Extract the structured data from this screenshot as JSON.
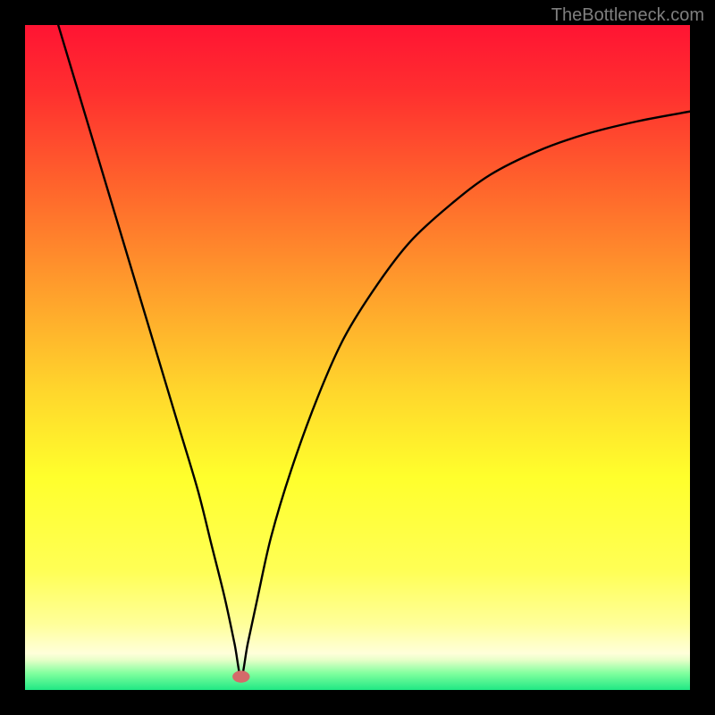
{
  "watermark": "TheBottleneck.com",
  "chart_data": {
    "type": "line",
    "title": "",
    "xlabel": "",
    "ylabel": "",
    "xlim": [
      0,
      100
    ],
    "ylim": [
      0,
      100
    ],
    "min_point_x": 32.5,
    "gradient_stops": [
      {
        "offset": 0.0,
        "color": "#ff1433"
      },
      {
        "offset": 0.1,
        "color": "#ff2f2f"
      },
      {
        "offset": 0.25,
        "color": "#ff672c"
      },
      {
        "offset": 0.4,
        "color": "#ff9f2c"
      },
      {
        "offset": 0.55,
        "color": "#ffd62c"
      },
      {
        "offset": 0.68,
        "color": "#ffff2c"
      },
      {
        "offset": 0.82,
        "color": "#ffff55"
      },
      {
        "offset": 0.9,
        "color": "#ffff99"
      },
      {
        "offset": 0.945,
        "color": "#ffffda"
      },
      {
        "offset": 0.955,
        "color": "#e6ffc8"
      },
      {
        "offset": 0.975,
        "color": "#80ff9e"
      },
      {
        "offset": 1.0,
        "color": "#20e884"
      }
    ],
    "series": [
      {
        "name": "bottleneck-curve",
        "color": "#000000",
        "x": [
          5,
          8,
          11,
          14,
          17,
          20,
          23,
          26,
          28,
          30,
          31.5,
          32.5,
          33.5,
          35,
          37,
          40,
          44,
          48,
          53,
          58,
          64,
          70,
          77,
          84,
          92,
          100
        ],
        "y": [
          100,
          90,
          80,
          70,
          60,
          50,
          40,
          30,
          22,
          14,
          7,
          2,
          7,
          14,
          23,
          33,
          44,
          53,
          61,
          67.5,
          73,
          77.5,
          81,
          83.5,
          85.5,
          87
        ]
      }
    ],
    "marker": {
      "x": 32.5,
      "y": 2,
      "rx": 1.3,
      "ry": 0.9,
      "fill": "#d46a6a"
    }
  }
}
